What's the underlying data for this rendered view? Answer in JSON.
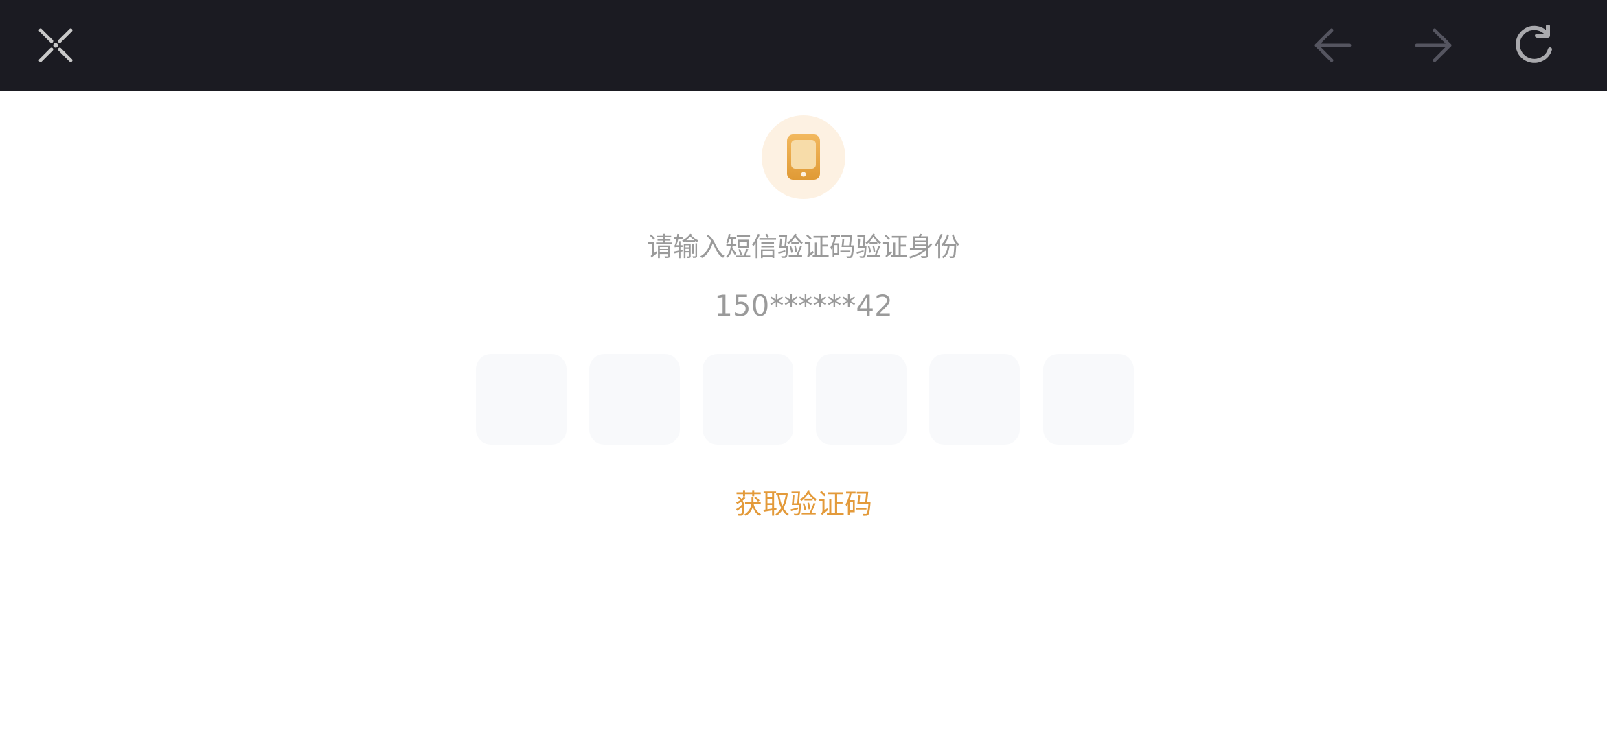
{
  "toolbar": {
    "close_icon": "close-icon",
    "back_icon": "arrow-left-icon",
    "forward_icon": "arrow-right-icon",
    "reload_icon": "reload-icon"
  },
  "verification": {
    "badge_icon": "phone-icon",
    "title": "请输入短信验证码验证身份",
    "phone_number": "150******42",
    "code_cells": [
      "",
      "",
      "",
      "",
      "",
      ""
    ],
    "get_code_label": "获取验证码"
  },
  "colors": {
    "topbar": "#1b1b22",
    "accent": "#e39a3a",
    "muted_text": "#9a9a9a",
    "cell_background": "#f8f9fb",
    "badge_background": "#fdf1e2"
  }
}
